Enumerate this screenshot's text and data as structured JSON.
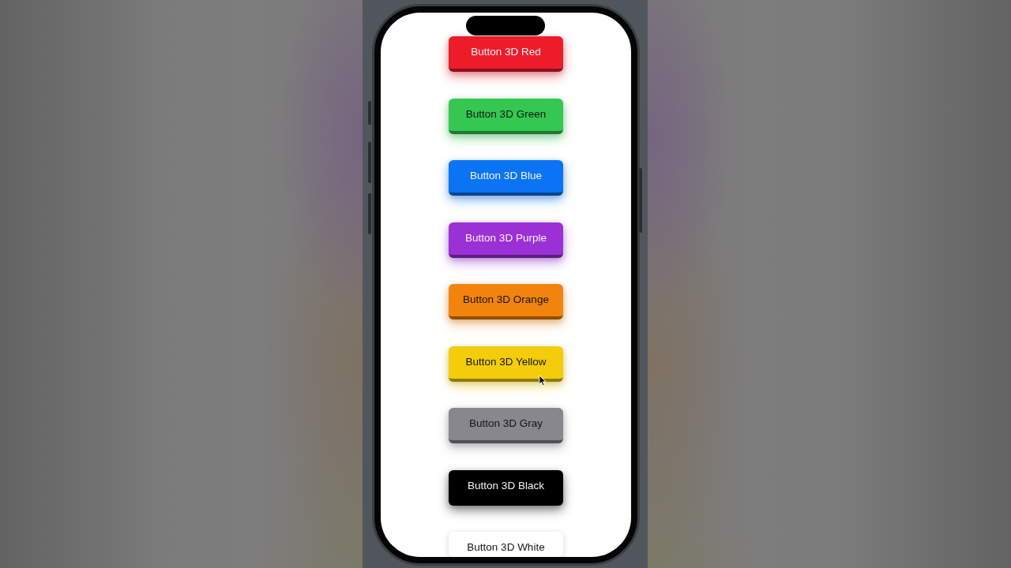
{
  "buttons": [
    {
      "label": "Button 3D Red",
      "color": "#ec1c2b"
    },
    {
      "label": "Button 3D Green",
      "color": "#34c853"
    },
    {
      "label": "Button 3D Blue",
      "color": "#0a74f4"
    },
    {
      "label": "Button 3D Purple",
      "color": "#9b30d6"
    },
    {
      "label": "Button 3D Orange",
      "color": "#f2840e"
    },
    {
      "label": "Button 3D Yellow",
      "color": "#f3cc0a"
    },
    {
      "label": "Button 3D Gray",
      "color": "#87878d"
    },
    {
      "label": "Button 3D Black",
      "color": "#000000"
    },
    {
      "label": "Button 3D White",
      "color": "#ffffff"
    }
  ]
}
